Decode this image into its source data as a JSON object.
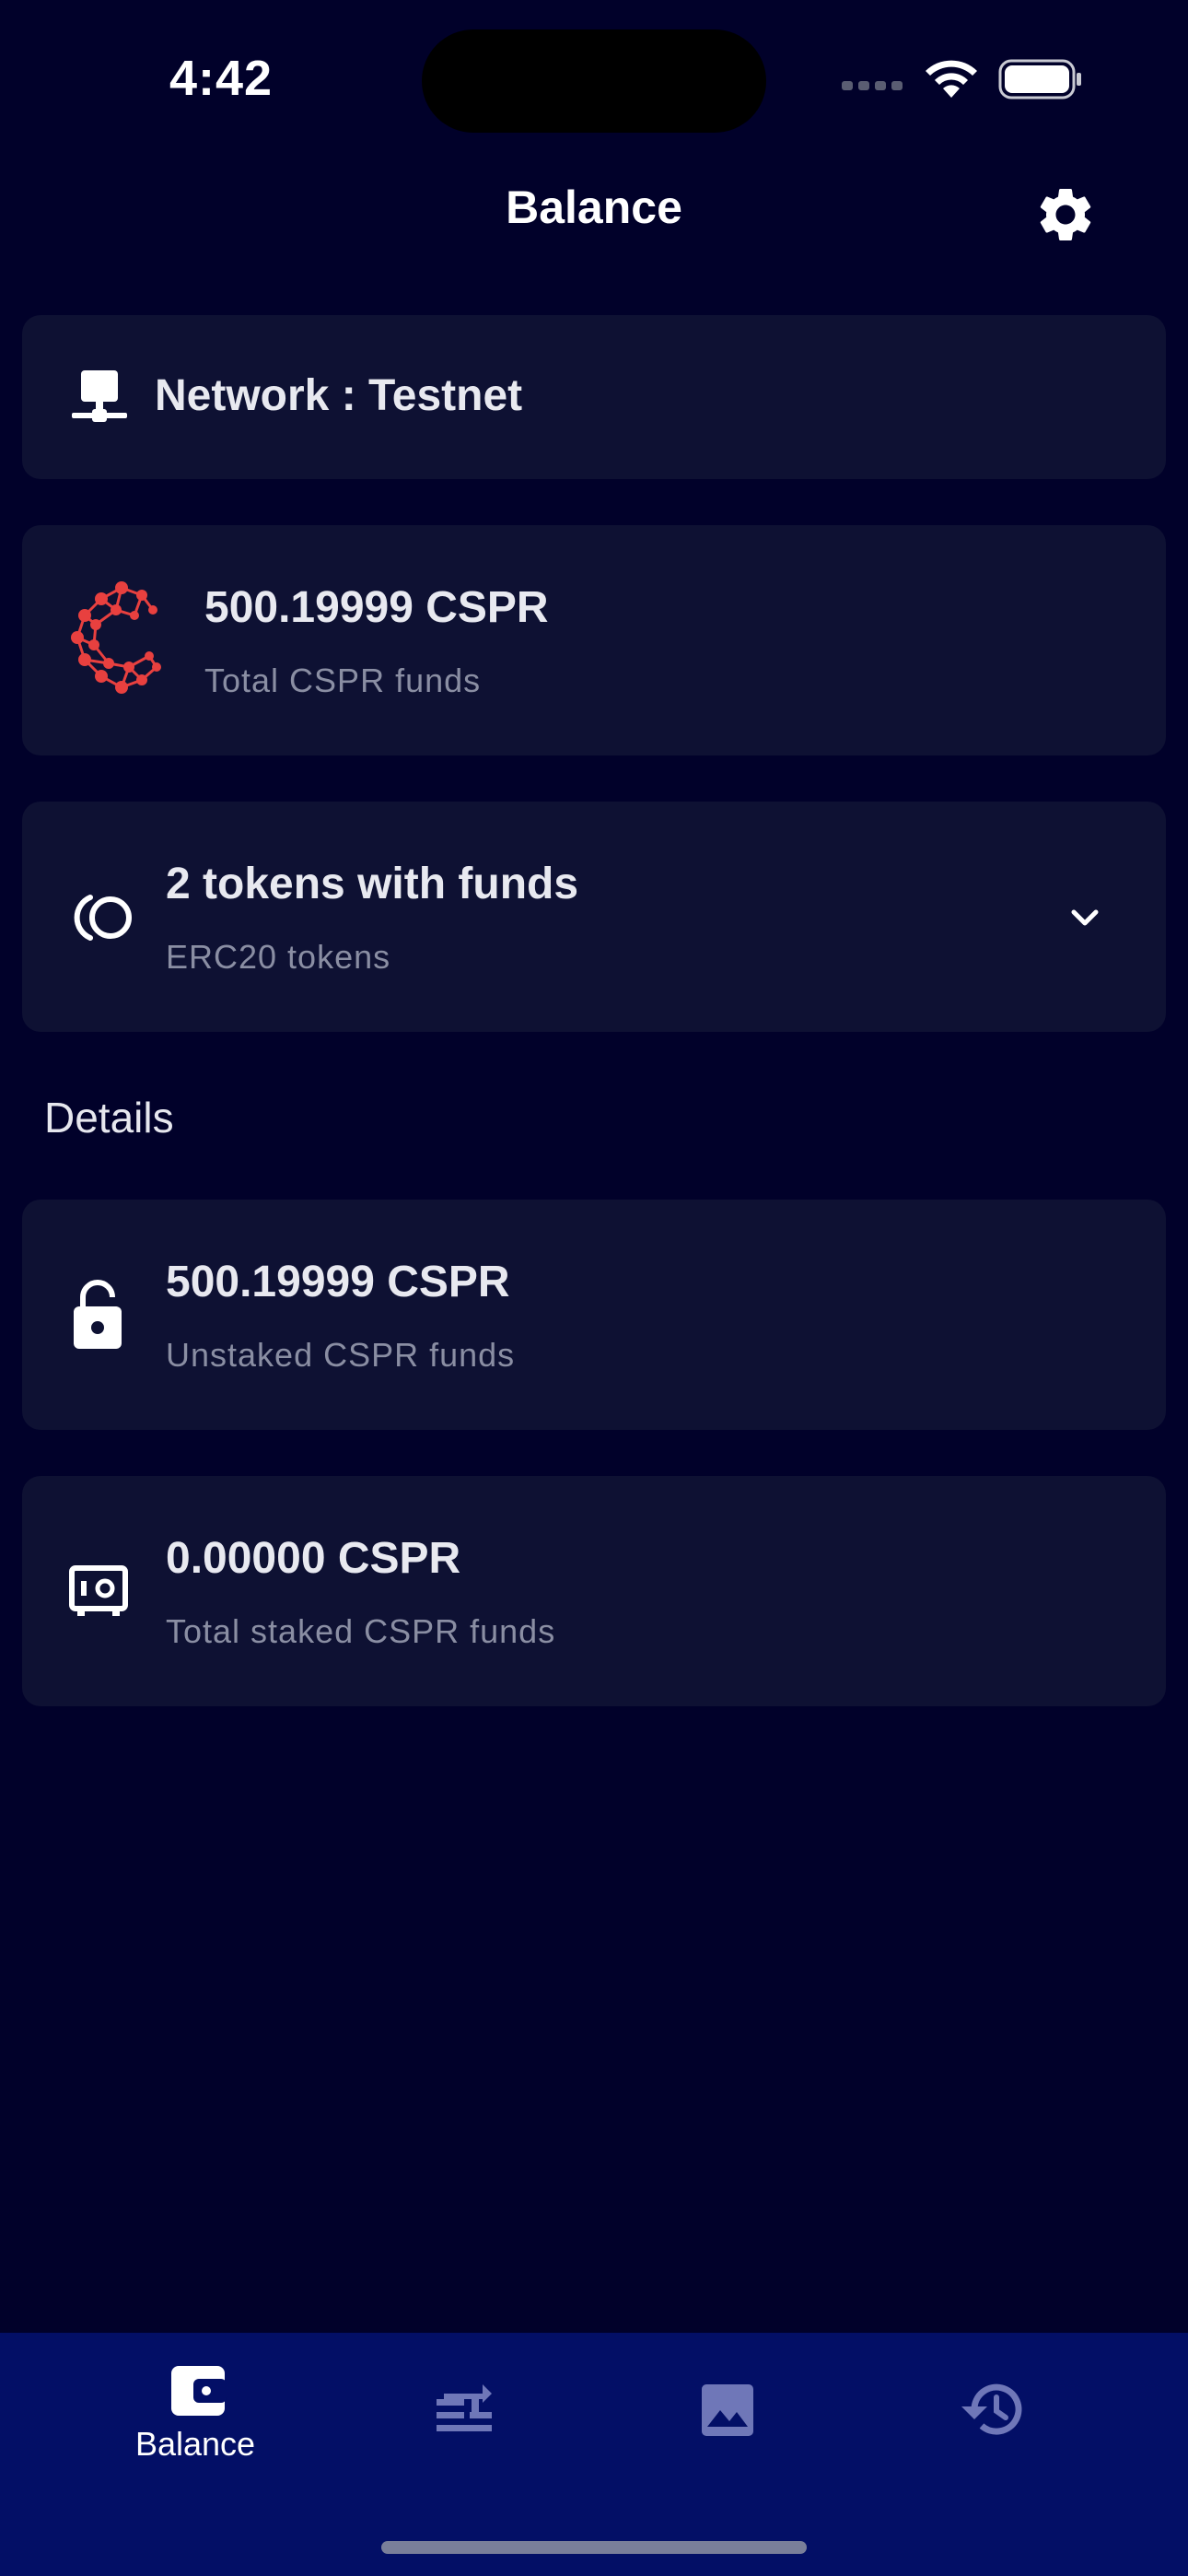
{
  "status_bar": {
    "time": "4:42"
  },
  "header": {
    "title": "Balance"
  },
  "network_card": {
    "label": "Network : Testnet"
  },
  "cspr_card": {
    "amount": "500.19999 CSPR",
    "caption": "Total CSPR funds"
  },
  "tokens_card": {
    "title": "2 tokens with funds",
    "caption": "ERC20 tokens"
  },
  "details": {
    "heading": "Details",
    "unstaked": {
      "amount": "500.19999 CSPR",
      "caption": "Unstaked CSPR funds"
    },
    "staked": {
      "amount": "0.00000 CSPR",
      "caption": "Total staked CSPR funds"
    }
  },
  "tab_bar": {
    "tabs": [
      {
        "label": "Balance",
        "icon": "wallet-icon",
        "active": true
      },
      {
        "label": "",
        "icon": "transfer-icon",
        "active": false
      },
      {
        "label": "",
        "icon": "image-icon",
        "active": false
      },
      {
        "label": "",
        "icon": "history-icon",
        "active": false
      }
    ]
  },
  "colors": {
    "background": "#01012a",
    "card": "#0e1133",
    "tab_bar": "#030f66",
    "brand_red": "#e8403f",
    "inactive_icon": "#6f77b8"
  }
}
